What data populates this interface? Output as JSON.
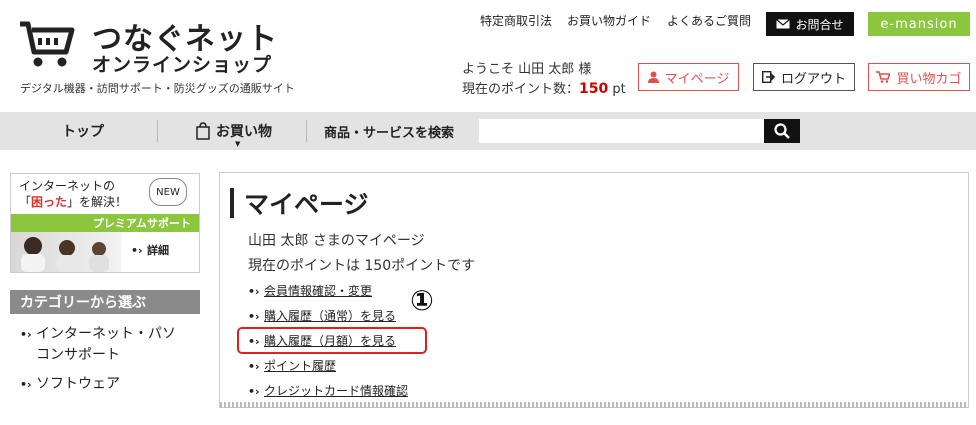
{
  "header": {
    "logo_line1": "つなぐネット",
    "logo_line2": "オンラインショップ",
    "tagline": "デジタル機器・訪問サポート・防災グッズの通販サイト",
    "links": [
      "特定商取引法",
      "お買い物ガイド",
      "よくあるご質問"
    ],
    "contact_label": "お問合せ",
    "emansion_label": "e-mansion",
    "welcome": "ようこそ 山田 太郎 様",
    "points_label": "現在のポイント数：",
    "points_value": "150",
    "points_unit": "pt",
    "mypage_label": "マイページ",
    "logout_label": "ログアウト",
    "cart_label": "買い物カゴ"
  },
  "nav": {
    "top": "トップ",
    "shopping": "お買い物",
    "search_label": "商品・サービスを検索",
    "search_placeholder": ""
  },
  "sidebar": {
    "banner_line1": "インターネットの",
    "banner_line2_pre": "「",
    "banner_line2_red": "困った",
    "banner_line2_post": "」を解決！",
    "banner_new": "NEW",
    "banner_premium": "プレミアムサポート",
    "banner_detail": "詳細",
    "category_header": "カテゴリーから選ぶ",
    "categories": [
      "インターネット・パソ",
      "コンサポート",
      "ソフトウェア"
    ]
  },
  "main": {
    "title": "マイページ",
    "user_line": "山田 太郎 さまのマイページ",
    "points_line": "現在のポイントは 150ポイントです",
    "menu": [
      "会員情報確認・変更",
      "購入履歴（通常）を見る",
      "購入履歴（月額）を見る",
      "ポイント履歴",
      "クレジットカード情報確認"
    ],
    "annotation": "①"
  },
  "colors": {
    "accent_red": "#e05050",
    "green": "#8cc63f",
    "nav_bg": "#e3e3e3"
  }
}
